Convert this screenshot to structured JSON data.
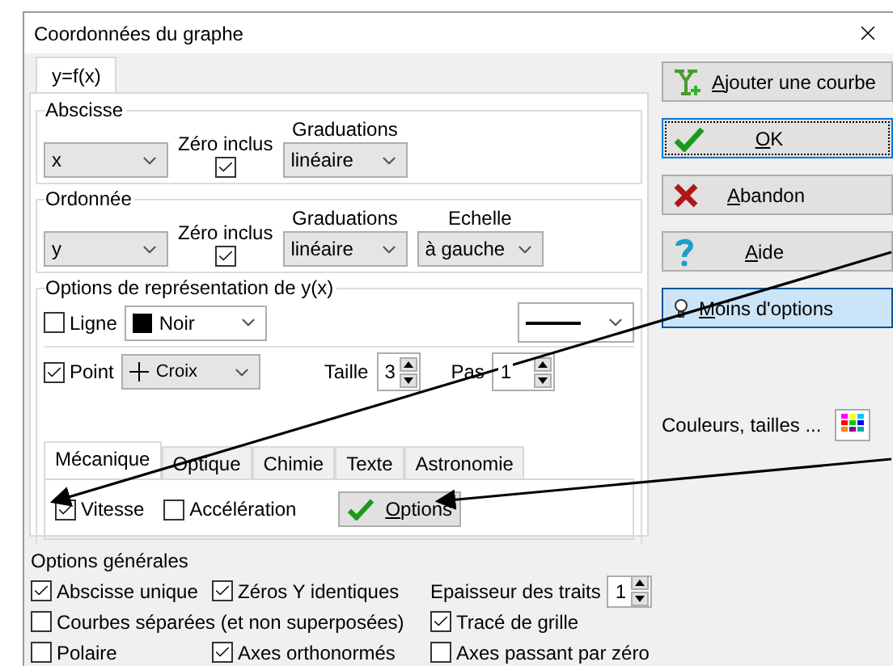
{
  "window": {
    "title": "Coordonnées du graphe"
  },
  "tabs": [
    {
      "label": "y=f(x)",
      "selected": true
    }
  ],
  "axes": [
    {
      "title": "Abscisse",
      "zero_label": "Zéro inclus",
      "graduations_label": "Graduations",
      "variable": "x",
      "zero_included": true,
      "graduations": "linéaire"
    },
    {
      "title": "Ordonnée",
      "zero_label": "Zéro inclus",
      "graduations_label": "Graduations",
      "scale_label": "Echelle",
      "variable": "y",
      "zero_included": true,
      "graduations": "linéaire",
      "scale": "à gauche"
    }
  ],
  "representation": {
    "title": "Options de représentation de y(x)",
    "line": {
      "label": "Ligne",
      "checked": false,
      "color_name": "Noir"
    },
    "point": {
      "label": "Point",
      "checked": true,
      "symbol": "Croix",
      "size_label": "Taille",
      "size": "3",
      "step_label": "Pas",
      "step": "1"
    },
    "subtabs": [
      {
        "label": "Mécanique",
        "selected": true
      },
      {
        "label": "Optique",
        "selected": false
      },
      {
        "label": "Chimie",
        "selected": false
      },
      {
        "label": "Texte",
        "selected": false
      },
      {
        "label": "Astronomie",
        "selected": false
      }
    ],
    "mechanics": {
      "checks": [
        {
          "label": "Vitesse",
          "checked": true
        },
        {
          "label": "Accélération",
          "checked": false
        }
      ],
      "options_button": "Options"
    }
  },
  "buttons": [
    {
      "kind": "add",
      "label": "Ajouter une courbe",
      "default": false,
      "pressed": false
    },
    {
      "kind": "ok",
      "label": "OK",
      "default": true,
      "pressed": false
    },
    {
      "kind": "cancel",
      "label": "Abandon",
      "default": false,
      "pressed": false
    },
    {
      "kind": "help",
      "label": "Aide",
      "default": false,
      "pressed": false
    },
    {
      "kind": "less",
      "label": "Moins d'options",
      "default": false,
      "pressed": true
    }
  ],
  "colors_label": "Couleurs, tailles ...",
  "general": {
    "title": "Options générales",
    "rows": [
      [
        {
          "kind": "check",
          "label": "Abscisse unique",
          "checked": true
        },
        {
          "kind": "check",
          "label": "Zéros Y identiques",
          "checked": true
        },
        {
          "kind": "spin",
          "label": "Epaisseur des traits",
          "value": "1"
        }
      ],
      [
        {
          "kind": "check",
          "label": "Courbes séparées (et non superposées)",
          "checked": false
        },
        "",
        {
          "kind": "check",
          "label": "Tracé de grille",
          "checked": true
        }
      ],
      [
        {
          "kind": "check",
          "label": "Polaire",
          "checked": false
        },
        {
          "kind": "check",
          "label": "Axes orthonormés",
          "checked": true
        },
        {
          "kind": "check",
          "label": "Axes passant par zéro",
          "checked": false
        }
      ]
    ]
  }
}
